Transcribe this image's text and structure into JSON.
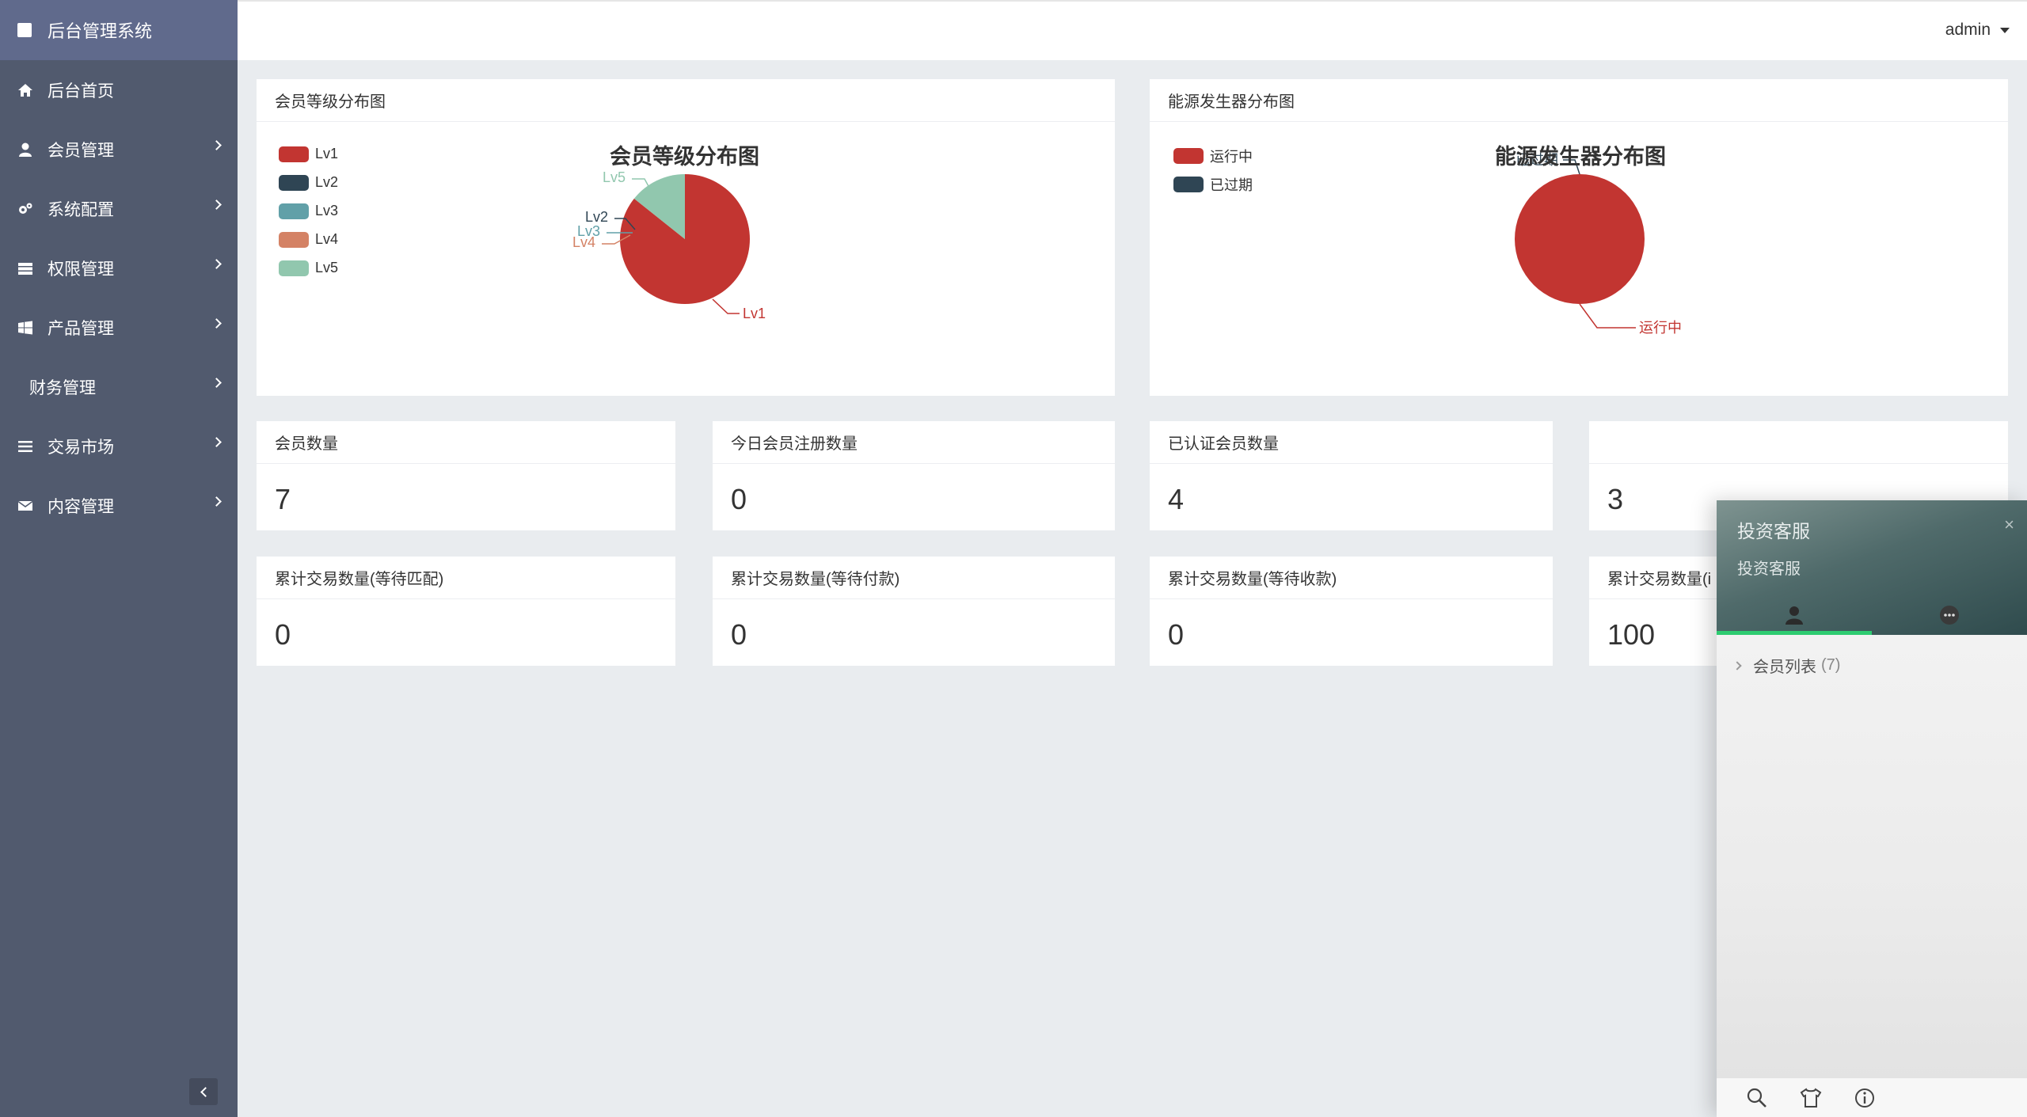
{
  "sidebar": {
    "brand": "后台管理系统",
    "items": [
      {
        "label": "后台首页",
        "icon": "home-icon",
        "has_children": false
      },
      {
        "label": "会员管理",
        "icon": "user-icon",
        "has_children": true
      },
      {
        "label": "系统配置",
        "icon": "cogs-icon",
        "has_children": true
      },
      {
        "label": "权限管理",
        "icon": "server-icon",
        "has_children": true
      },
      {
        "label": "产品管理",
        "icon": "windows-icon",
        "has_children": true
      },
      {
        "label": "财务管理",
        "icon": "",
        "has_children": true
      },
      {
        "label": "交易市场",
        "icon": "list-icon",
        "has_children": true
      },
      {
        "label": "内容管理",
        "icon": "envelope-icon",
        "has_children": true
      }
    ]
  },
  "header": {
    "user": "admin"
  },
  "charts": {
    "member_level": {
      "panel_title": "会员等级分布图",
      "chart_title": "会员等级分布图",
      "legend": [
        "Lv1",
        "Lv2",
        "Lv3",
        "Lv4",
        "Lv5"
      ]
    },
    "generator": {
      "panel_title": "能源发生器分布图",
      "chart_title": "能源发生器分布图",
      "legend": [
        "运行中",
        "已过期"
      ]
    }
  },
  "chart_data": [
    {
      "type": "pie",
      "title": "会员等级分布图",
      "categories": [
        "Lv1",
        "Lv2",
        "Lv3",
        "Lv4",
        "Lv5"
      ],
      "values": [
        6,
        0,
        0,
        0,
        1
      ],
      "colors": [
        "#c23531",
        "#2f4554",
        "#61a0a8",
        "#d48265",
        "#91c7ae"
      ],
      "legend_position": "top-left"
    },
    {
      "type": "pie",
      "title": "能源发生器分布图",
      "categories": [
        "运行中",
        "已过期"
      ],
      "values": [
        1,
        0
      ],
      "colors": [
        "#c23531",
        "#2f4554"
      ],
      "legend_position": "top-left"
    }
  ],
  "stats": [
    {
      "label": "会员数量",
      "value": "7"
    },
    {
      "label": "今日会员注册数量",
      "value": "0"
    },
    {
      "label": "已认证会员数量",
      "value": "4"
    },
    {
      "label": "",
      "value": "3"
    },
    {
      "label": "累计交易数量(等待匹配)",
      "value": "0"
    },
    {
      "label": "累计交易数量(等待付款)",
      "value": "0"
    },
    {
      "label": "累计交易数量(等待收款)",
      "value": "0"
    },
    {
      "label": "累计交易数量(i",
      "value": "100"
    }
  ],
  "chat": {
    "title": "投资客服",
    "subtitle": "投资客服",
    "close": "×",
    "group_label": "会员列表",
    "group_count": "(7)",
    "accent": "#2ecc71"
  }
}
